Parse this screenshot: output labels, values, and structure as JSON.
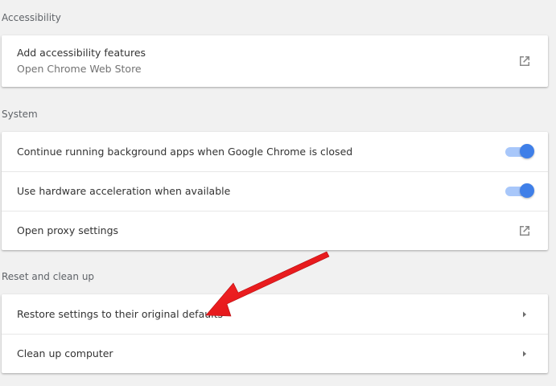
{
  "sections": {
    "accessibility": {
      "title": "Accessibility",
      "items": [
        {
          "label": "Add accessibility features",
          "sublabel": "Open Chrome Web Store",
          "control": "external-link-icon"
        }
      ]
    },
    "system": {
      "title": "System",
      "items": [
        {
          "label": "Continue running background apps when Google Chrome is closed",
          "control": "toggle",
          "checked": true
        },
        {
          "label": "Use hardware acceleration when available",
          "control": "toggle",
          "checked": true
        },
        {
          "label": "Open proxy settings",
          "control": "external-link-icon"
        }
      ]
    },
    "reset": {
      "title": "Reset and clean up",
      "items": [
        {
          "label": "Restore settings to their original defaults",
          "control": "arrow-right-icon"
        },
        {
          "label": "Clean up computer",
          "control": "arrow-right-icon"
        }
      ]
    }
  },
  "colors": {
    "background": "#f1f1f1",
    "card": "#ffffff",
    "toggle_knob": "#3f7fe8",
    "toggle_track": "#a8c7fa",
    "annotation_arrow": "#e8141c"
  }
}
